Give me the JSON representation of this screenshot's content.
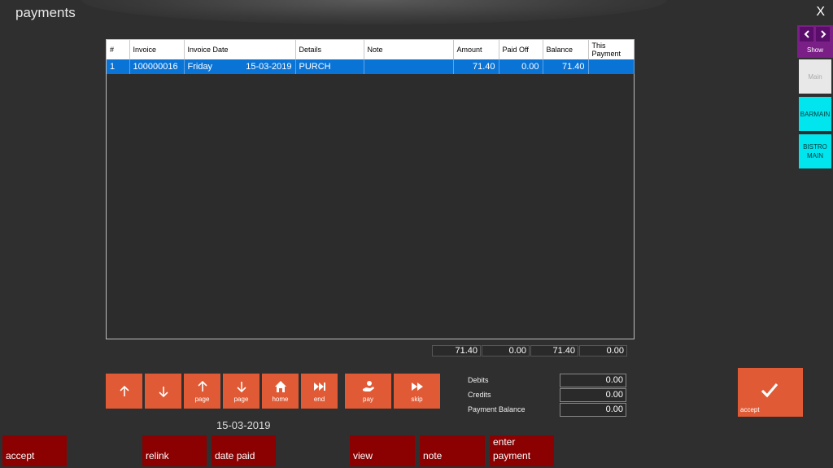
{
  "window": {
    "title": "payments",
    "close_label": "X"
  },
  "grid": {
    "columns": [
      "#",
      "Invoice",
      "Invoice Date",
      "Details",
      "Note",
      "Amount",
      "Paid Off",
      "Balance",
      "This Payment"
    ],
    "rows": [
      {
        "num": "1",
        "invoice": "100000016",
        "day": "Friday",
        "date": "15-03-2019",
        "details": "PURCH",
        "note": "",
        "amount": "71.40",
        "paid_off": "0.00",
        "balance": "71.40",
        "this_payment": ""
      }
    ]
  },
  "totals": {
    "amount": "71.40",
    "paid_off": "0.00",
    "balance": "71.40",
    "this_payment": "0.00"
  },
  "nav_buttons": {
    "up": "",
    "down": "",
    "page_up": "page",
    "page_down": "page",
    "home": "home",
    "end": "end",
    "pay": "pay",
    "skip": "skip"
  },
  "summary": {
    "debits_label": "Debits",
    "debits": "0.00",
    "credits_label": "Credits",
    "credits": "0.00",
    "balance_label": "Payment Balance",
    "balance": "0.00"
  },
  "accept_big_label": "accept",
  "date_display": "15-03-2019",
  "bottom_buttons": {
    "accept": "accept",
    "relink": "relink",
    "date_paid": "date paid",
    "view": "view",
    "note": "note",
    "enter_payment": "enter payment"
  },
  "right_panel": {
    "show_label": "Show",
    "locations": [
      "Main",
      "BARMAIN",
      "BISTRO MAIN"
    ]
  },
  "colors": {
    "accent": "#e05a35",
    "dark_red": "#8b0000",
    "selection": "#0a74d6",
    "cyan": "#00e5ee",
    "purple": "#7a1f86"
  }
}
